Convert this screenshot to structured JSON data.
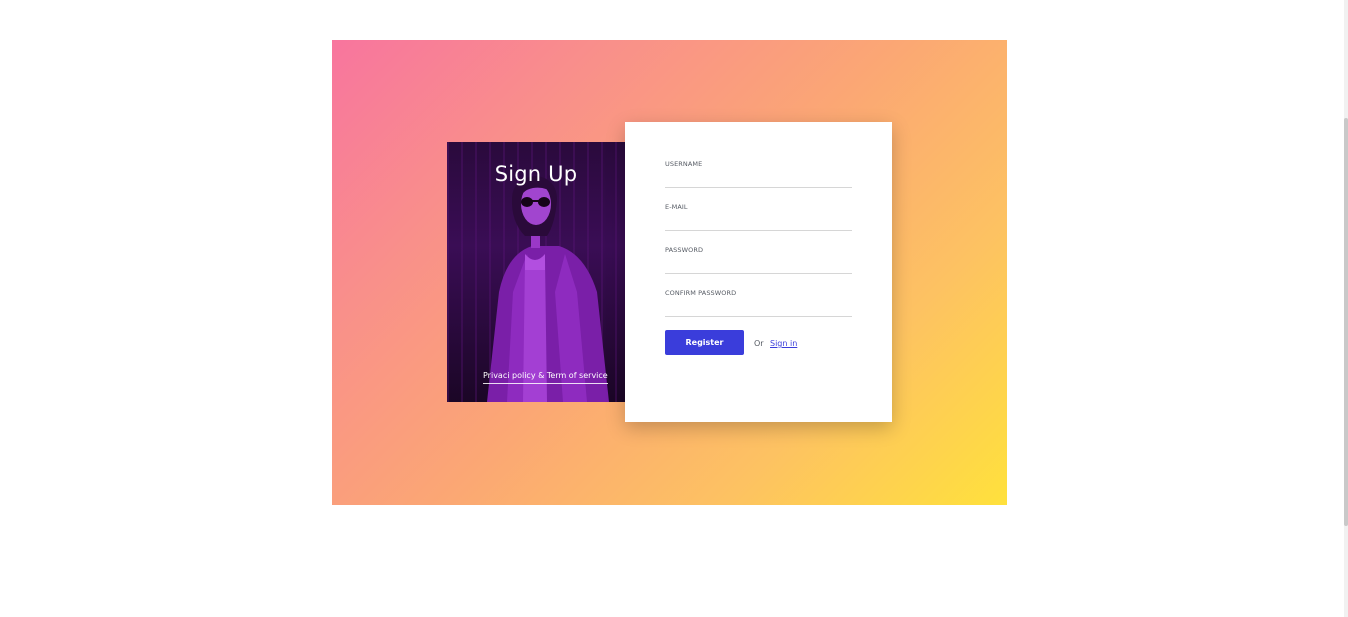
{
  "signup": {
    "title": "Sign Up",
    "policy_link": "Privaci policy & Term of service"
  },
  "form": {
    "username_label": "USERNAME",
    "email_label": "E-MAIL",
    "password_label": "PASSWORD",
    "confirm_password_label": "CONFIRM PASSWORD",
    "register_label": "Register",
    "or_text": "Or",
    "signin_label": "Sign in"
  },
  "colors": {
    "gradient_start": "#f8759e",
    "gradient_end": "#ffe13c",
    "accent": "#3a3ddb",
    "photo_tint": "#8a2bb8"
  },
  "icons": {
    "photo": "woman-in-coat-photo"
  }
}
